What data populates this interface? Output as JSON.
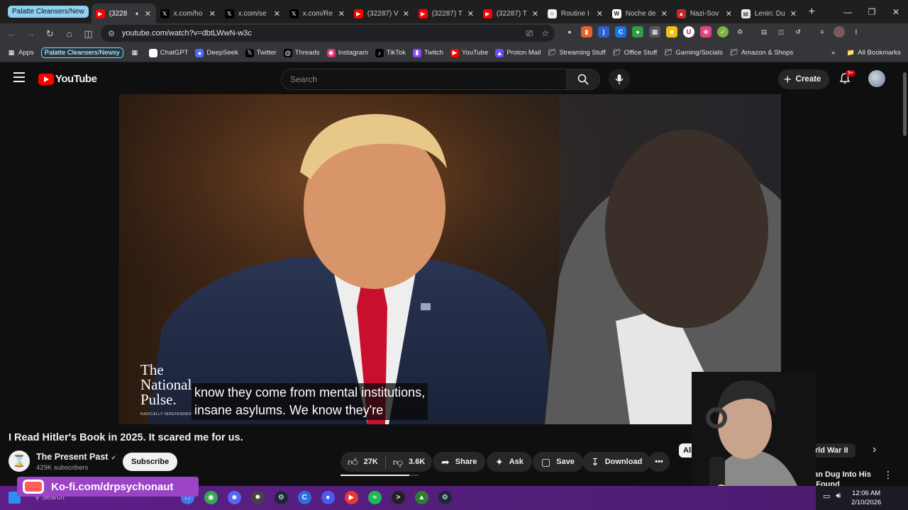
{
  "browser": {
    "tab_group": "Palatte Cleansers/New",
    "tabs": [
      {
        "title": "(3228",
        "favicon": "youtube-icon",
        "active": true,
        "audio": true
      },
      {
        "title": "x.com/ho",
        "favicon": "x-icon"
      },
      {
        "title": "x.com/se",
        "favicon": "x-icon"
      },
      {
        "title": "x.com/Re",
        "favicon": "x-icon"
      },
      {
        "title": "(32287) V",
        "favicon": "youtube-icon"
      },
      {
        "title": "(32287) T",
        "favicon": "youtube-icon"
      },
      {
        "title": "(32287) T",
        "favicon": "youtube-icon"
      },
      {
        "title": "Routine I",
        "favicon": "globe-icon"
      },
      {
        "title": "Noche de",
        "favicon": "wikipedia-icon"
      },
      {
        "title": "Nazi-Sov",
        "favicon": "pdf-icon"
      },
      {
        "title": "Lenin: Du",
        "favicon": "document-icon"
      }
    ],
    "url": "youtube.com/watch?v=dbtLWwN-w3c",
    "bookmarks": [
      {
        "label": "Apps",
        "icon": "grid-icon"
      },
      {
        "label": "Palatte Cleansers/Newsy",
        "icon": "",
        "chip": true
      },
      {
        "label": "",
        "icon": "grid-icon"
      },
      {
        "label": "ChatGPT",
        "icon": "chatgpt-icon"
      },
      {
        "label": "DeepSeek",
        "icon": "deepseek-icon"
      },
      {
        "label": "Twitter",
        "icon": "x-icon"
      },
      {
        "label": "Threads",
        "icon": "threads-icon"
      },
      {
        "label": "Instagram",
        "icon": "instagram-icon"
      },
      {
        "label": "TikTok",
        "icon": "tiktok-icon"
      },
      {
        "label": "Twitch",
        "icon": "twitch-icon"
      },
      {
        "label": "YouTube",
        "icon": "youtube-icon"
      },
      {
        "label": "Proton Mail",
        "icon": "proton-icon"
      },
      {
        "label": "Streaming Stuff",
        "icon": "folder-icon"
      },
      {
        "label": "Office Stuff",
        "icon": "folder-icon"
      },
      {
        "label": "Gaming/Socials",
        "icon": "folder-icon"
      },
      {
        "label": "Amazon & Shops",
        "icon": "folder-icon"
      }
    ],
    "all_bookmarks": "All Bookmarks"
  },
  "youtube": {
    "logo": "YouTube",
    "search_placeholder": "Search",
    "create_label": "Create",
    "notif_badge": "9+",
    "video": {
      "caption_line1": "know they come from mental institutions,",
      "caption_line2": "insane asylums. We know they're",
      "watermark_line1": "The",
      "watermark_line2": "National",
      "watermark_line3": "Pulse.",
      "watermark_sub": "RADICALLY INDEPENDENT"
    },
    "title": "I Read Hitler's Book in 2025. It scared me for us.",
    "channel": {
      "name": "The Present Past",
      "subscribers": "429K subscribers"
    },
    "subscribe_label": "Subscribe",
    "likes": "27K",
    "dislikes": "3.6K",
    "like_ratio": 0.88,
    "share_label": "Share",
    "ask_label": "Ask",
    "save_label": "Save",
    "download_label": "Download",
    "chips": {
      "all": "All",
      "ww2": "World War II"
    },
    "rec_title": "Man Dug Into His ... Found"
  },
  "overlay": {
    "kofi": "Ko-fi.com/drpsychonaut"
  },
  "taskbar": {
    "search": "Search",
    "time": "12:06 AM",
    "date": "2/10/2026"
  },
  "colors": {
    "youtube_red": "#ff0000",
    "kofi_purple": "#9b44c5",
    "taskbar_purple": "#5e1f88"
  }
}
